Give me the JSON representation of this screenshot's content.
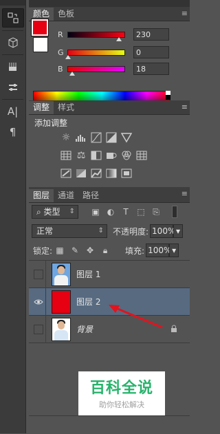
{
  "toolstrip": {
    "icons": [
      "history-icon",
      "3d-icon",
      "brush-preset-icon",
      "tool-options-icon",
      "character-icon",
      "paragraph-icon"
    ],
    "character_label": "A|",
    "paragraph_label": "¶"
  },
  "color_panel": {
    "tabs": [
      "颜色",
      "色板"
    ],
    "foreground": "#e60012",
    "background": "#ffffff",
    "channels": [
      {
        "label": "R",
        "value": "230",
        "fraction": 0.902
      },
      {
        "label": "G",
        "value": "0",
        "fraction": 0.0
      },
      {
        "label": "B",
        "value": "18",
        "fraction": 0.07
      }
    ]
  },
  "adjust_panel": {
    "tabs": [
      "调整",
      "样式"
    ],
    "heading": "添加调整",
    "row1_icons": [
      "brightness-icon",
      "levels-icon",
      "curves-icon",
      "exposure-icon",
      "vibrance-icon"
    ],
    "row2_icons": [
      "hue-saturation-icon",
      "color-balance-icon",
      "black-white-icon",
      "photo-filter-icon",
      "channel-mixer-icon",
      "color-lookup-icon"
    ],
    "row3_icons": [
      "invert-icon",
      "posterize-icon",
      "threshold-icon",
      "gradient-map-icon",
      "selective-color-icon"
    ]
  },
  "layers_panel": {
    "tabs": [
      "图层",
      "通道",
      "路径"
    ],
    "filter_label": "类型",
    "blend_mode": "正常",
    "opacity_label": "不透明度:",
    "opacity_value": "100%",
    "lock_label": "锁定:",
    "fill_label": "填充:",
    "fill_value": "100%",
    "layers": [
      {
        "name": "图层 1",
        "visible": false,
        "selected": false,
        "thumb": "portrait-blue"
      },
      {
        "name": "图层 2",
        "visible": true,
        "selected": true,
        "thumb": "red-fill"
      },
      {
        "name": "背景",
        "visible": false,
        "selected": false,
        "thumb": "portrait-white",
        "locked": true
      }
    ]
  },
  "watermark": {
    "title": "百科全说",
    "subtitle": "助你轻松解决"
  },
  "colors": {
    "panel_bg": "#535353",
    "selected_row": "#576a80",
    "arrow": "#e0141e",
    "watermark_green": "#27b36b"
  }
}
